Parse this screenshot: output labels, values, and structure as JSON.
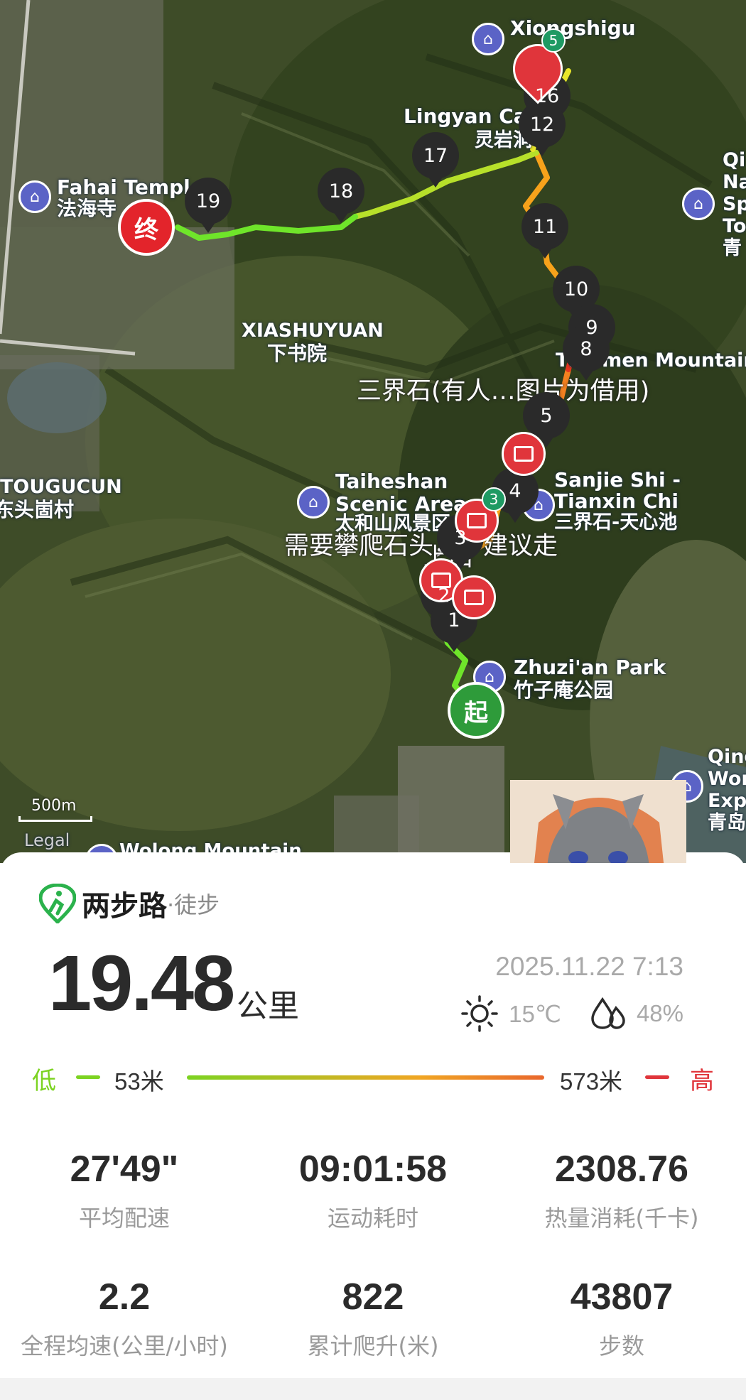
{
  "map": {
    "labels": {
      "xiongshigu": "Xiongshigu",
      "lingyan_en": "Lingyan Cave",
      "lingyan_zh": "灵岩洞",
      "fahai_en": "Fahai Temple",
      "fahai_zh": "法海寺",
      "xiashuyuan_en": "XIASHUYUAN",
      "xiashuyuan_zh": "下书院",
      "qinan_1": "Qi",
      "qinan_2": "Na",
      "qinan_3": "Sp",
      "qinan_4": "To",
      "qinan_5": "青",
      "tianmen": "Tianmen Mountain",
      "sanjie_note": "三界石(有人…图片为借用)",
      "tougucun_en": "TOUGUCUN",
      "tougucun_zh": "东头崮村",
      "taiheshan_en1": "Taiheshan",
      "taiheshan_en2": "Scenic Area",
      "taiheshan_zh": "太和山风景区",
      "sanjie_en1": "Sanjie Shi -",
      "sanjie_en2": "Tianxin Chi",
      "sanjie_zh": "三界石-天心池",
      "climb_note": "需要攀爬石头，不建议走",
      "climb_note2": "上山",
      "zhuzian_en": "Zhuzi'an Park",
      "zhuzian_zh": "竹子庵公园",
      "qing_1": "Qing",
      "qing_2": "Wor",
      "qing_3": "Expo",
      "qing_4": "青岛",
      "scale": "500m",
      "legal": "Legal",
      "wolong": "Wolong Mountain"
    },
    "markers": [
      "1",
      "2",
      "3",
      "4",
      "5",
      "8",
      "9",
      "10",
      "11",
      "12",
      "16",
      "17",
      "18",
      "19"
    ],
    "badges": [
      "3",
      "5"
    ],
    "start_label": "起",
    "end_label": "终"
  },
  "card": {
    "brand_name": "两步路",
    "brand_sub": "·徒步",
    "distance": "19.48",
    "distance_unit": "公里",
    "datetime": "2025.11.22 7:13",
    "temperature": "15℃",
    "humidity": "48%",
    "elev_low_label": "低",
    "elev_low": "53米",
    "elev_high": "573米",
    "elev_high_label": "高",
    "stats": [
      {
        "value": "27'49\"",
        "label": "平均配速"
      },
      {
        "value": "09:01:58",
        "label": "运动耗时"
      },
      {
        "value": "2308.76",
        "label": "热量消耗(千卡)"
      },
      {
        "value": "2.2",
        "label": "全程均速(公里/小时)"
      },
      {
        "value": "822",
        "label": "累计爬升(米)"
      },
      {
        "value": "43807",
        "label": "步数"
      }
    ]
  },
  "colors": {
    "route_low": "#6fe52a",
    "route_mid": "#f7a21b",
    "route_high": "#e7341f",
    "start": "#2e9b3a",
    "end": "#e3242b",
    "poi": "#5b63c6"
  },
  "icons": [
    "app-logo-icon",
    "sun-icon",
    "humidity-icon",
    "poi-temple-icon",
    "photo-icon",
    "pin-icon"
  ]
}
